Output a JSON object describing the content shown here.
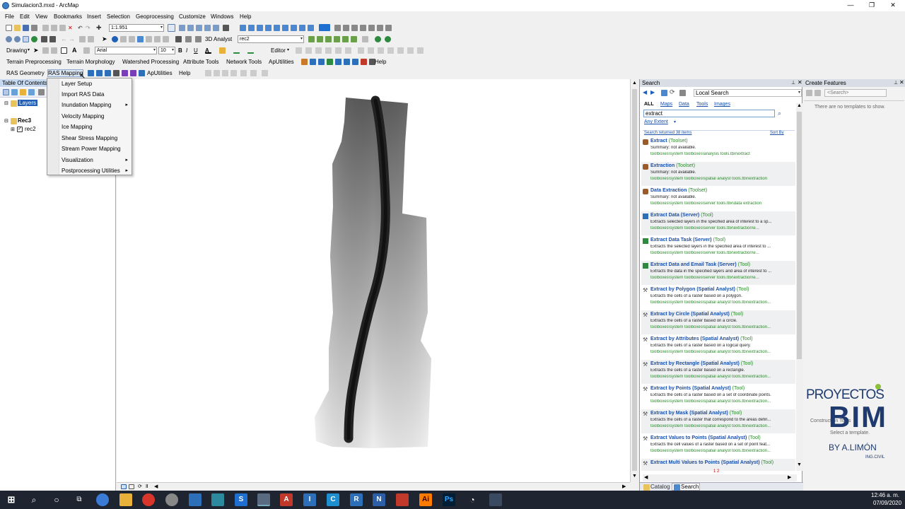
{
  "window": {
    "title": "Simulacion3.mxd - ArcMap"
  },
  "menubar": [
    "File",
    "Edit",
    "View",
    "Bookmarks",
    "Insert",
    "Selection",
    "Geoprocessing",
    "Customize",
    "Windows",
    "Help"
  ],
  "toolbar1": {
    "scale": "1:1.951",
    "analyst": "3D Analyst",
    "layer": "rec2"
  },
  "toolbar_draw": {
    "drawing": "Drawing",
    "font": "Arial",
    "size": "10",
    "editor": "Editor"
  },
  "toolbar_hydro": {
    "items": [
      "Terrain Preprocessing",
      "Terrain Morphology",
      "Watershed Processing",
      "Attribute Tools",
      "Network Tools",
      "ApUtilities",
      "Help"
    ]
  },
  "toolbar_ras": {
    "items": [
      "RAS Geometry",
      "RAS Mapping",
      "ApUtilities",
      "Help"
    ]
  },
  "toc": {
    "title": "Table Of Contents",
    "layers": "Layers",
    "group": "Rec3",
    "layer": "rec2"
  },
  "ras_menu": {
    "items": [
      {
        "label": "Layer Setup",
        "submenu": false
      },
      {
        "label": "Import RAS Data",
        "submenu": false
      },
      {
        "label": "Inundation Mapping",
        "submenu": true
      },
      {
        "label": "Velocity Mapping",
        "submenu": false
      },
      {
        "label": "Ice Mapping",
        "submenu": false
      },
      {
        "label": "Shear Stress Mapping",
        "submenu": false
      },
      {
        "label": "Stream Power Mapping",
        "submenu": false
      },
      {
        "label": "Visualization",
        "submenu": true
      },
      {
        "label": "Postprocessing Utilities",
        "submenu": true
      }
    ]
  },
  "search": {
    "title": "Search",
    "scope": "Local Search",
    "tabs": [
      "ALL",
      "Maps",
      "Data",
      "Tools",
      "Images"
    ],
    "query": "extract",
    "extent": "Any Extent",
    "count_text": "Search returned 38 items",
    "sort": "Sort By",
    "pages": "1 2",
    "bottom_tabs": [
      "Catalog",
      "Search"
    ],
    "results": [
      {
        "name": "Extract",
        "kind": "(Toolset)",
        "summary": "Summary: not available.",
        "path": "toolboxes\\system toolboxes\\analysis tools.tbx\\extract"
      },
      {
        "name": "Extraction",
        "kind": "(Toolset)",
        "summary": "Summary: not available.",
        "path": "toolboxes\\system toolboxes\\spatial analyst tools.tbx\\extraction"
      },
      {
        "name": "Data Extraction",
        "kind": "(Toolset)",
        "summary": "Summary: not available.",
        "path": "toolboxes\\system toolboxes\\server tools.tbx\\data extraction"
      },
      {
        "name": "Extract Data (Server)",
        "kind": "(Tool)",
        "summary": "Extracts selected layers in the specified area of interest to a sp...",
        "path": "toolboxes\\system toolboxes\\server tools.tbx\\extraction\\e..."
      },
      {
        "name": "Extract Data Task (Server)",
        "kind": "(Tool)",
        "summary": "Extracts the selected layers in the specified area of interest to ...",
        "path": "toolboxes\\system toolboxes\\server tools.tbx\\extraction\\e..."
      },
      {
        "name": "Extract Data and Email Task (Server)",
        "kind": "(Tool)",
        "summary": "Extracts the data in the specified layers and area of interest to ...",
        "path": "toolboxes\\system toolboxes\\server tools.tbx\\extraction\\e..."
      },
      {
        "name": "Extract by Polygon (Spatial Analyst)",
        "kind": "(Tool)",
        "summary": "Extracts the cells of a raster based on a polygon.",
        "path": "toolboxes\\system toolboxes\\spatial analyst tools.tbx\\extraction..."
      },
      {
        "name": "Extract by Circle (Spatial Analyst)",
        "kind": "(Tool)",
        "summary": "Extracts the cells of a raster based on a circle.",
        "path": "toolboxes\\system toolboxes\\spatial analyst tools.tbx\\extraction..."
      },
      {
        "name": "Extract by Attributes (Spatial Analyst)",
        "kind": "(Tool)",
        "summary": "Extracts the cells of a raster based on a logical query.",
        "path": "toolboxes\\system toolboxes\\spatial analyst tools.tbx\\extraction..."
      },
      {
        "name": "Extract by Rectangle (Spatial Analyst)",
        "kind": "(Tool)",
        "summary": "Extracts the cells of a raster based on a rectangle.",
        "path": "toolboxes\\system toolboxes\\spatial analyst tools.tbx\\extraction..."
      },
      {
        "name": "Extract by Points (Spatial Analyst)",
        "kind": "(Tool)",
        "summary": "Extracts the cells of a raster based on a set of coordinate points.",
        "path": "toolboxes\\system toolboxes\\spatial analyst tools.tbx\\extraction..."
      },
      {
        "name": "Extract by Mask (Spatial Analyst)",
        "kind": "(Tool)",
        "summary": "Extracts the cells of a raster that correspond to the areas defin...",
        "path": "toolboxes\\system toolboxes\\spatial analyst tools.tbx\\extraction..."
      },
      {
        "name": "Extract Values to Points (Spatial Analyst)",
        "kind": "(Tool)",
        "summary": "Extracts the cell values of a raster based on a set of point feat...",
        "path": "toolboxes\\system toolboxes\\spatial analyst tools.tbx\\extraction..."
      },
      {
        "name": "Extract Multi Values to Points (Spatial Analyst)",
        "kind": "(Tool)",
        "summary": "",
        "path": ""
      }
    ]
  },
  "create_features": {
    "title": "Create Features",
    "search_placeholder": "<Search>",
    "empty_text": "There are no templates to show.",
    "behind_label": "Construction Tools",
    "behind_hint": "Select a template."
  },
  "watermark": {
    "line1": "PROYECTOS",
    "line2": "BIM",
    "line3": "BY A.LIMÓN",
    "line4": "ING.CIVIL"
  },
  "clock": {
    "time": "12:46 a. m.",
    "date": "07/09/2020"
  },
  "colors": {
    "toc_header": "#c6d9f0",
    "link_blue": "#1a4fa8",
    "path_green": "#2a8a2a",
    "taskbar": "#1f2530",
    "river": "#2a2a2a"
  }
}
